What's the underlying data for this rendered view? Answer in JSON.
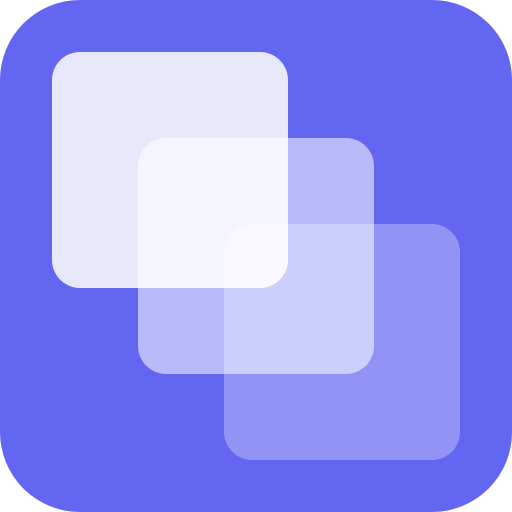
{
  "icon": {
    "semantic": "stacked-windows-icon",
    "background_color": "#6366F1",
    "layer_color": "#FFFFFF",
    "layers": [
      {
        "name": "back",
        "opacity": 0.85
      },
      {
        "name": "middle",
        "opacity": 0.55
      },
      {
        "name": "front",
        "opacity": 0.3
      }
    ]
  }
}
